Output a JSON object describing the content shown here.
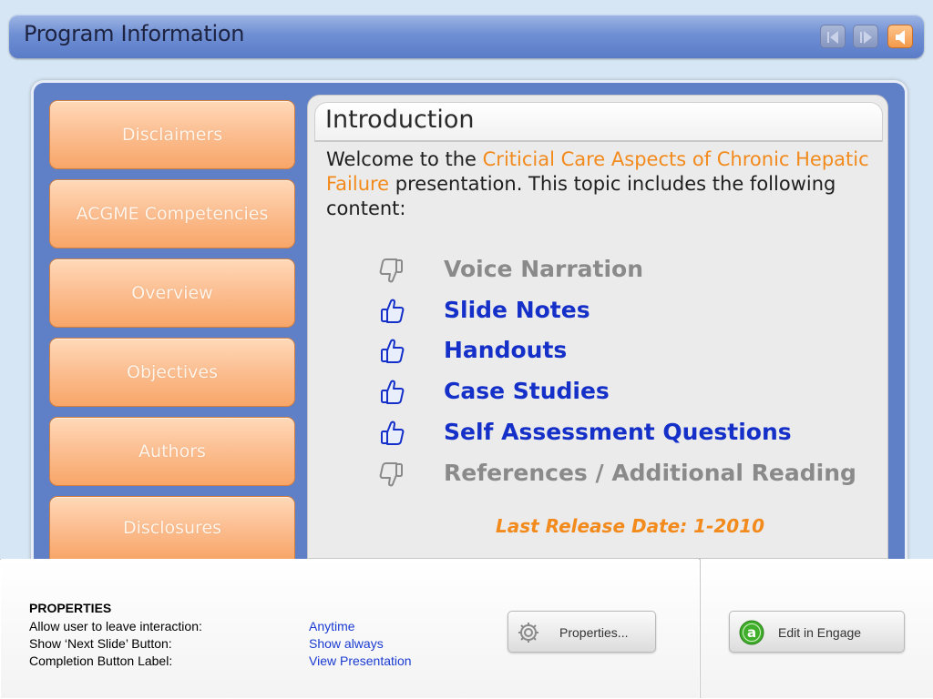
{
  "header": {
    "title": "Program Information",
    "prev_icon": "prev-arrow-icon",
    "next_icon": "next-arrow-icon",
    "audio_icon": "speaker-icon"
  },
  "nav": [
    {
      "label": "Disclaimers"
    },
    {
      "label": "ACGME Competencies"
    },
    {
      "label": "Overview"
    },
    {
      "label": "Objectives"
    },
    {
      "label": "Authors"
    },
    {
      "label": "Disclosures"
    }
  ],
  "content": {
    "title": "Introduction",
    "intro_prefix": "Welcome to the ",
    "intro_highlight": "Criticial Care Aspects of Chronic Hepatic Failure",
    "intro_suffix": " presentation.  This topic includes the following content:",
    "features": [
      {
        "label": "Voice Narration",
        "included": false,
        "icon": "thumbs-down-icon",
        "color": "#8a8a8a"
      },
      {
        "label": "Slide Notes",
        "included": true,
        "icon": "thumbs-up-icon",
        "color": "#1530c8"
      },
      {
        "label": "Handouts",
        "included": true,
        "icon": "thumbs-up-icon",
        "color": "#1530c8"
      },
      {
        "label": "Case Studies",
        "included": true,
        "icon": "thumbs-up-icon",
        "color": "#1530c8"
      },
      {
        "label": "Self Assessment Questions",
        "included": true,
        "icon": "thumbs-up-icon",
        "color": "#1530c8"
      },
      {
        "label": "References / Additional Reading",
        "included": false,
        "icon": "thumbs-down-icon",
        "color": "#8a8a8a"
      }
    ],
    "release": "Last Release Date: 1-2010",
    "highlight_color": "#f28a1c"
  },
  "properties": {
    "heading": "PROPERTIES",
    "rows": [
      {
        "label": "Allow user to leave interaction:",
        "value": "Anytime"
      },
      {
        "label": "Show ‘Next Slide’ Button:",
        "value": "Show always"
      },
      {
        "label": "Completion Button Label:",
        "value": "View Presentation"
      }
    ],
    "properties_button": "Properties...",
    "properties_icon": "gear-icon",
    "engage_button": "Edit in Engage",
    "engage_icon": "engage-logo-icon"
  }
}
